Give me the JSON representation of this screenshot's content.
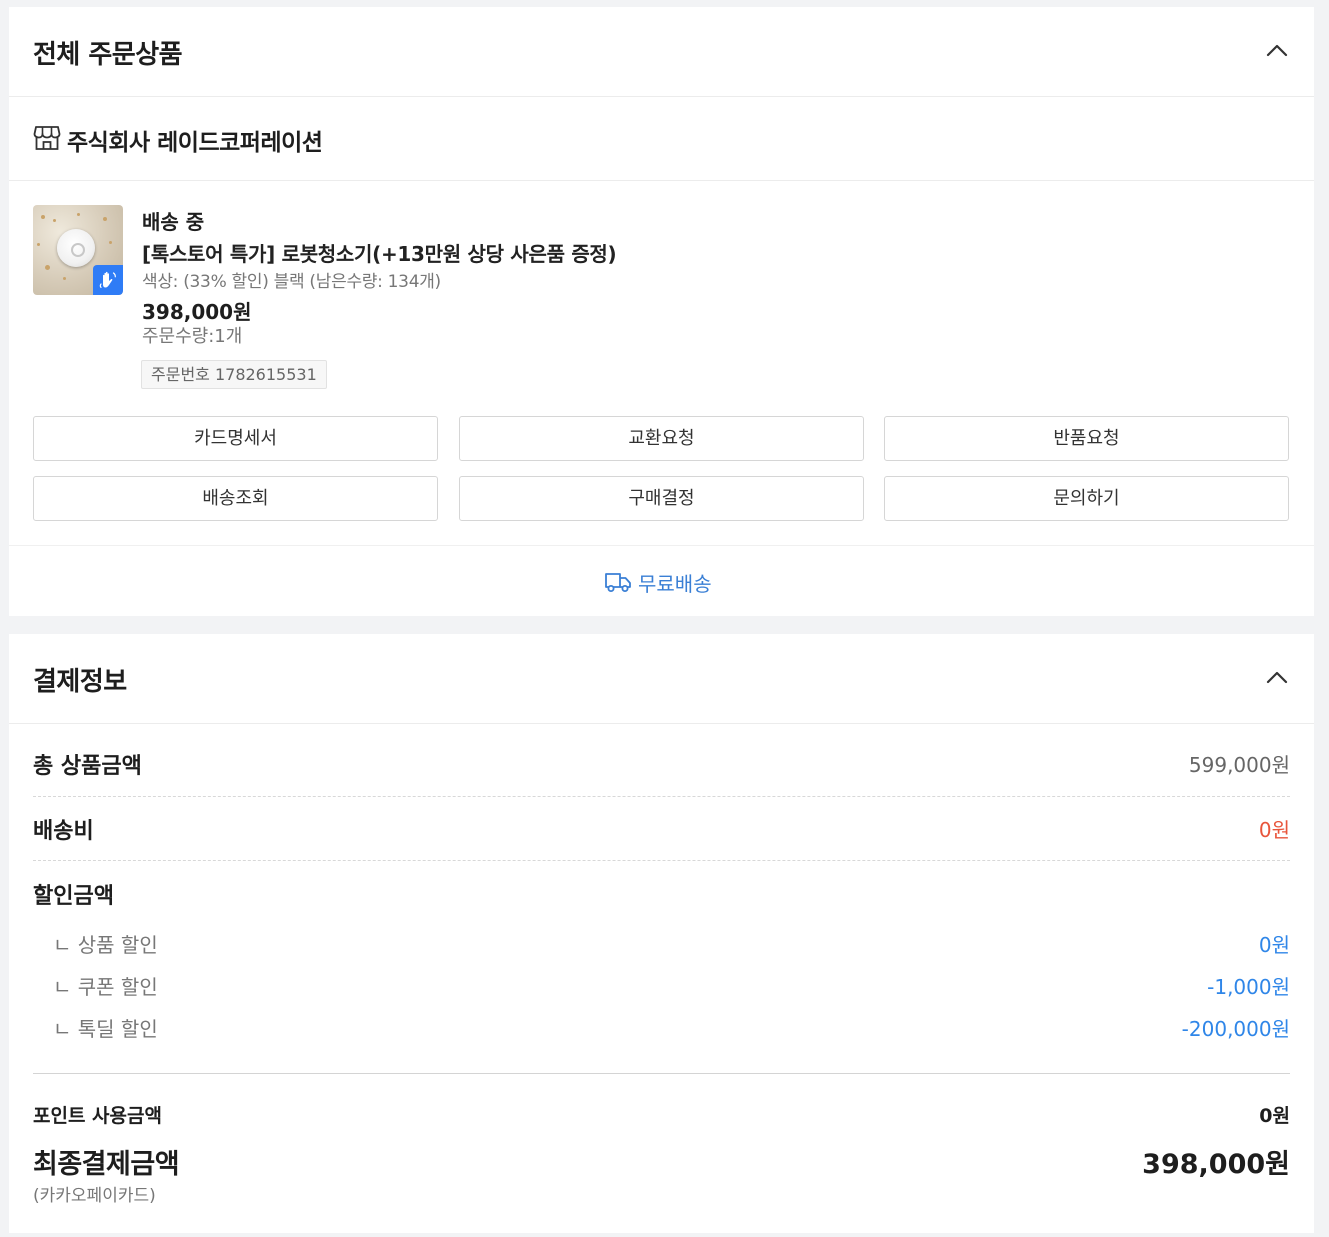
{
  "orders": {
    "title": "전체 주문상품",
    "seller": {
      "name": "주식회사 레이드코퍼레이션",
      "icon": "store-icon"
    },
    "product": {
      "status": "배송 중",
      "name": "[톡스토어 특가] 로봇청소기(+13만원 상당 사은품 증정)",
      "option": "색상: (33% 할인) 블랙 (남은수량: 134개)",
      "price": "398,000원",
      "quantity": "주문수량:1개",
      "order_number": "주문번호 1782615531",
      "thumbnail_badge_icon": "hand-wave-icon",
      "badge_color": "#2f7cf6"
    },
    "buttons": [
      "카드명세서",
      "교환요청",
      "반품요청",
      "배송조회",
      "구매결정",
      "문의하기"
    ],
    "shipping": {
      "label": "무료배송",
      "icon": "truck-icon",
      "color": "#3a7fd5"
    }
  },
  "payment": {
    "title": "결제정보",
    "total_label": "총 상품금액",
    "total_value": "599,000원",
    "shipping_label": "배송비",
    "shipping_value": "0원",
    "shipping_value_color": "#e8553b",
    "discount_label": "할인금액",
    "discounts": [
      {
        "label": "ㄴ 상품 할인",
        "value": "0원"
      },
      {
        "label": "ㄴ 쿠폰 할인",
        "value": "-1,000원"
      },
      {
        "label": "ㄴ 톡딜 할인",
        "value": "-200,000원"
      }
    ],
    "discount_color": "#2f86e8",
    "point_label": "포인트 사용금액",
    "point_value": "0원",
    "final_label": "최종결제금액",
    "final_value": "398,000원",
    "method": "(카카오페이카드)"
  }
}
